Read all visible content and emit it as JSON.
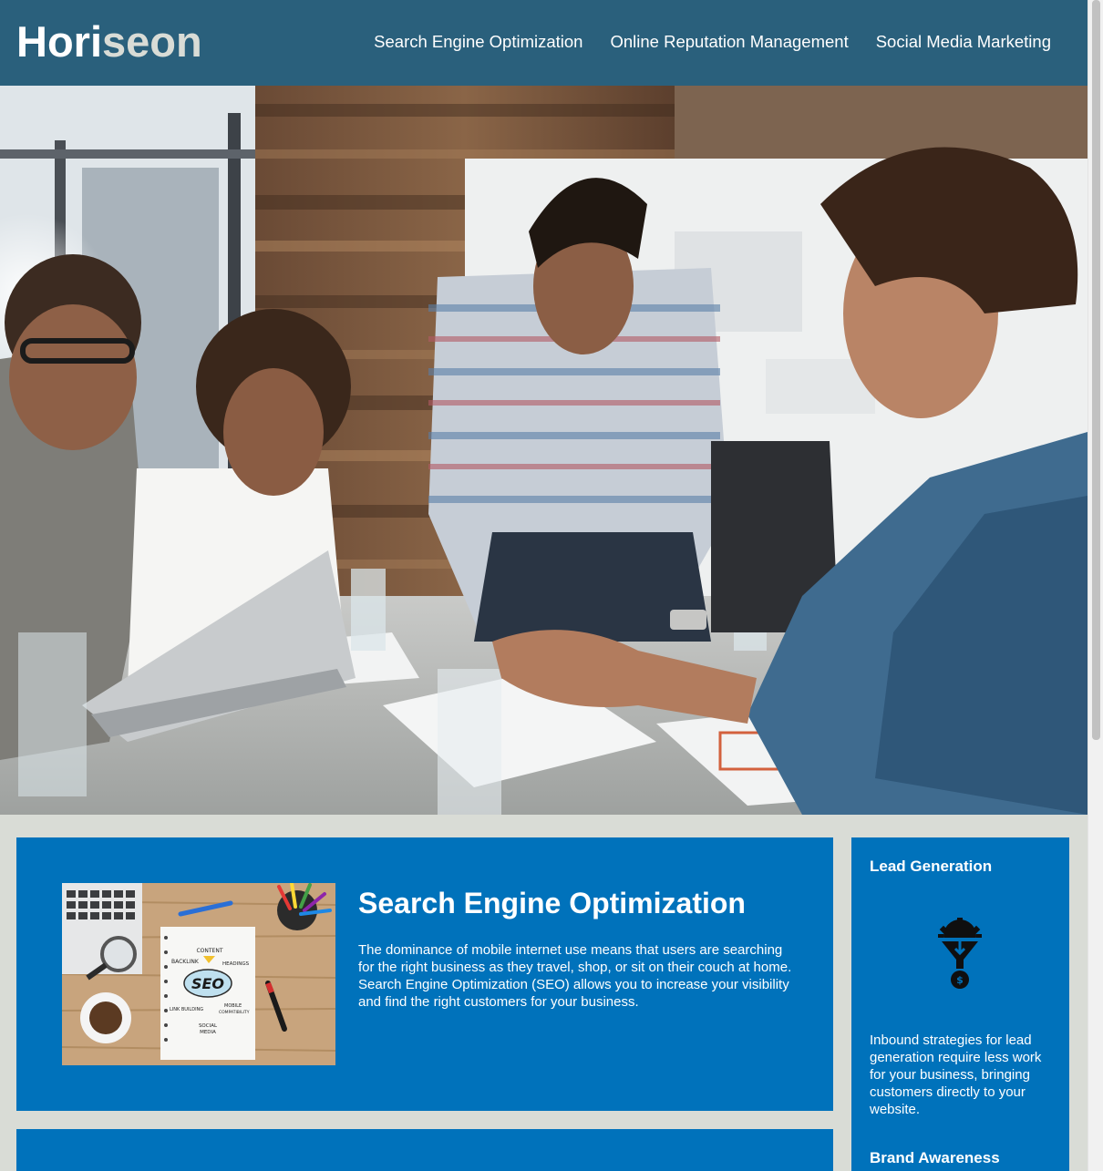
{
  "header": {
    "logo_part1": "Hori",
    "logo_part2": "seon",
    "nav": [
      {
        "label": "Search Engine Optimization"
      },
      {
        "label": "Online Reputation Management"
      },
      {
        "label": "Social Media Marketing"
      }
    ]
  },
  "seo_card": {
    "title": "Search Engine Optimization",
    "body": "The dominance of mobile internet use means that users are searching for the right business as they travel, shop, or sit on their couch at home. Search Engine Optimization (SEO) allows you to increase your visibility and find the right customers for your business.",
    "image": {
      "labels": {
        "center": "SEO",
        "content": "CONTENT",
        "backlink": "BACKLINK",
        "headings": "HEADINGS",
        "link_building": "LINK BUILDING",
        "mobile": "MOBILE",
        "compatibility": "COMPATIBILITY",
        "social": "SOCIAL",
        "media": "MEDIA"
      }
    }
  },
  "sidebar": {
    "lead": {
      "title": "Lead Generation",
      "text": "Inbound strategies for lead generation require less work for your business, bringing customers directly to your website.",
      "icon": "lead-funnel-icon"
    },
    "brand": {
      "title": "Brand Awareness"
    }
  },
  "colors": {
    "header": "#2a607c",
    "card": "#0072bb",
    "page_bg": "#d9dcd6",
    "logo_accent": "#d9dcd6"
  }
}
